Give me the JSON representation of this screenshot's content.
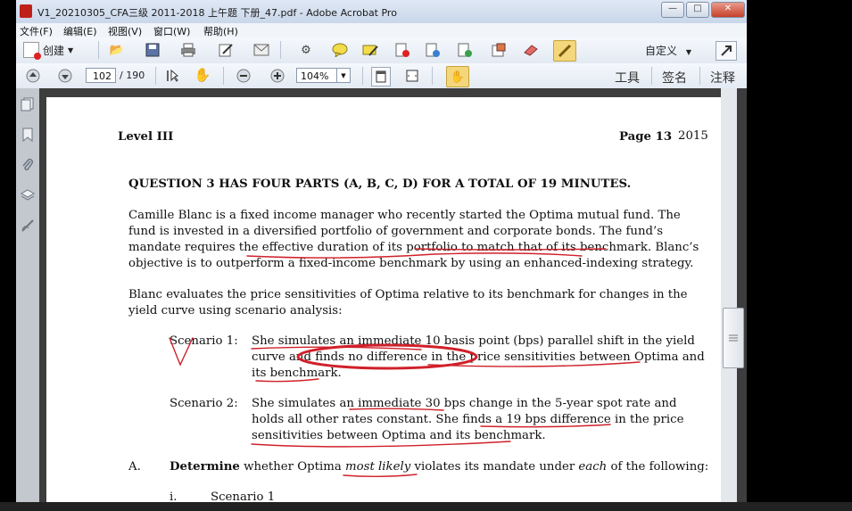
{
  "window": {
    "title": "V1_20210305_CFA三级 2011-2018 上午题 下册_47.pdf - Adobe Acrobat Pro",
    "minimize": "—",
    "maximize": "□",
    "close": "✕"
  },
  "menu": [
    "文件(F)",
    "编辑(E)",
    "视图(V)",
    "窗口(W)",
    "帮助(H)"
  ],
  "toolbar": {
    "create_label": "创建",
    "customize_label": "自定义"
  },
  "nav": {
    "page_current": "102",
    "page_total": "/ 190",
    "zoom": "104%"
  },
  "right_tabs": [
    "工具",
    "签名",
    "注释"
  ],
  "icons": [
    "create-icon",
    "open-folder-icon",
    "save-icon",
    "print-icon",
    "edit-icon",
    "email-icon",
    "gear-icon",
    "comment-icon",
    "highlight-icon",
    "pdf-delete-icon",
    "pdf-export-icon",
    "pdf-insert-icon",
    "stamp-icon",
    "eraser-icon",
    "pencil-icon",
    "expand-icon"
  ],
  "document": {
    "header_left": "Level III",
    "header_page": "Page 13",
    "header_year": "2015",
    "question_heading": "QUESTION 3 HAS FOUR PARTS (A, B, C, D) FOR A TOTAL OF 19 MINUTES.",
    "para1": [
      "Camille Blanc is a fixed income manager who recently started the Optima mutual fund.  The",
      "fund is invested in a diversified portfolio of government and corporate bonds.  The fund’s",
      "mandate requires the effective duration of its portfolio to match that of its benchmark.  Blanc’s",
      "objective is to outperform a fixed-income benchmark by using an enhanced-indexing strategy."
    ],
    "para2": [
      "Blanc evaluates the price sensitivities of Optima relative to its benchmark for changes in the",
      "yield curve using scenario analysis:"
    ],
    "scenario1_label": "Scenario 1:",
    "scenario1_lines": [
      "She simulates an immediate 10 basis point (bps) parallel shift in the yield",
      "curve and finds no difference in the price sensitivities between Optima and",
      "its benchmark."
    ],
    "scenario2_label": "Scenario 2:",
    "scenario2_lines": [
      "She simulates an immediate 30 bps change in the 5-year spot rate and",
      "holds all other rates constant.  She finds a 19 bps difference in the price",
      "sensitivities between Optima and its benchmark."
    ],
    "partA_letter": "A.",
    "partA_bold": "Determine",
    "partA_text1": " whether Optima ",
    "partA_italic1": "most likely",
    "partA_text2": " violates its mandate under ",
    "partA_italic2": "each",
    "partA_text3": " of the following:",
    "sub_i": "i.",
    "sub_i_text": "Scenario 1"
  }
}
